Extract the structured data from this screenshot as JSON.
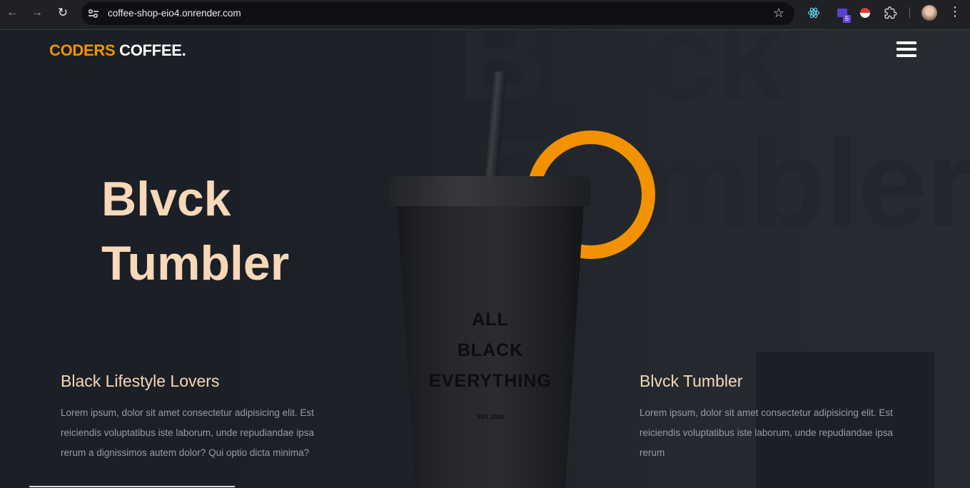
{
  "browser": {
    "url": "coffee-shop-eio4.onrender.com",
    "extensions": [
      {
        "icon": "react-icon"
      },
      {
        "icon": "extension-badge-icon",
        "badge": "5"
      },
      {
        "icon": "pokeball-icon"
      },
      {
        "icon": "puzzle-icon"
      }
    ],
    "back_icon": "←",
    "forward_icon": "→",
    "reload_icon": "↻",
    "star_icon": "☆",
    "menu_icon": "⋮"
  },
  "header": {
    "logo_primary": "CODERS",
    "logo_secondary": "COFFEE."
  },
  "background": {
    "word_top": "Blvck",
    "word_bottom": "Tumbler"
  },
  "hero": {
    "title_line1": "Blvck",
    "title_line2": "Tumbler"
  },
  "product": {
    "cup_line1": "ALL",
    "cup_line2": "BLACK",
    "cup_line3": "EVERYTHING",
    "cup_est": "EST. 2018"
  },
  "cards": [
    {
      "title": "Black Lifestyle Lovers",
      "text": "Lorem ipsum, dolor sit amet consectetur adipisicing elit. Est reiciendis voluptatibus iste laborum, unde repudiandae ipsa rerum a dignissimos autem dolor? Qui optio dicta minima?"
    },
    {
      "title": "Blvck Tumbler",
      "text": "Lorem ipsum, dolor sit amet consectetur adipisicing elit. Est reiciendis voluptatibus iste laborum, unde repudiandae ipsa rerum"
    }
  ],
  "colors": {
    "accent": "#f39200",
    "title": "#f7d8b8",
    "background": "#1e232a"
  }
}
